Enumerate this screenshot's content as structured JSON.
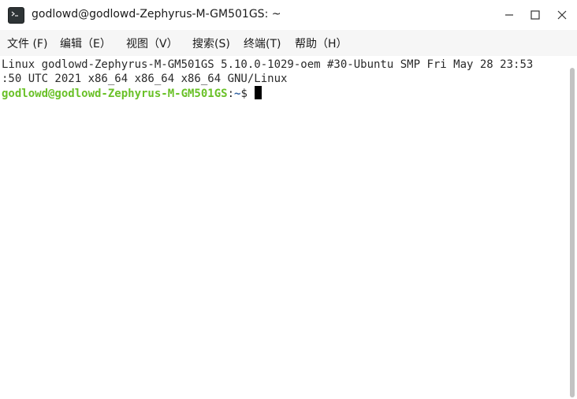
{
  "window": {
    "title": "godlowd@godlowd-Zephyrus-M-GM501GS: ~"
  },
  "icons": {
    "app": "terminal-icon",
    "minimize": "minimize-icon",
    "maximize": "maximize-icon",
    "close": "close-icon"
  },
  "menu": {
    "file": "文件 (F)",
    "edit": "编辑（E）",
    "view": "视图（V）",
    "search": "搜索(S)",
    "terminal": "终端(T)",
    "help": "帮助（H）"
  },
  "terminal": {
    "line1": "Linux godlowd-Zephyrus-M-GM501GS 5.10.0-1029-oem #30-Ubuntu SMP Fri May 28 23:53",
    "line2": ":50 UTC 2021 x86_64 x86_64 x86_64 GNU/Linux",
    "prompt_user": "godlowd@godlowd-Zephyrus-M-GM501GS",
    "prompt_colon": ":",
    "prompt_path": "~",
    "prompt_symbol": "$ "
  },
  "colors": {
    "prompt_user": "#6ac128",
    "prompt_path": "#3465a4",
    "menubar_bg": "#f6f6f6",
    "cursor": "#000000"
  }
}
